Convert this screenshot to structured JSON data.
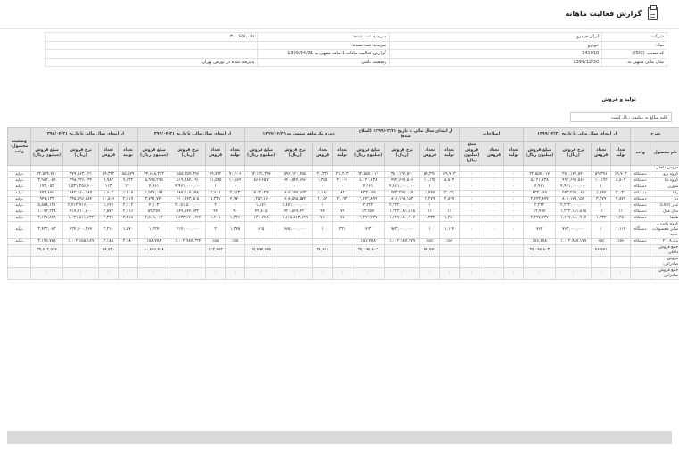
{
  "page": {
    "title": "گزارش فعالیت ماهانه",
    "clipboard_icon": "clipboard-icon"
  },
  "info": [
    [
      "شرکت:",
      "ایران خودرو",
      "سرمایه ثبت شده:",
      "۳۰۱,۶۵۶,۰۶۸"
    ],
    [
      "نماد:",
      "خودرو",
      "سرمایه ثبت نشده:",
      "۰"
    ],
    [
      "کد صنعت (ISIC):",
      "341010",
      "گزارش فعالیت ماهانه 1 ماهه منتهی به 1399/04/31",
      ""
    ],
    [
      "سال مالی منتهی به:",
      "1399/12/30",
      "وضعیت ناشر:",
      "پذیرفته شده در بورس تهران"
    ]
  ],
  "section_title": "تولید و فروش",
  "unit_label": "کلیه مبالغ به میلیون ریال است",
  "table": {
    "group_headers": [
      "شرح",
      "از ابتدای سال مالی تا تاریخ ۱۳۹۹/۰۳/۳۱",
      "اصلاحات",
      "از ابتدای سال مالی تا تاریخ ۱۳۹۹/۰۳/۳۱ (اصلاح شده)",
      "دوره یک ماهه منتهی به ۱۳۹۹/۰۴/۳۱",
      "از ابتدای سال مالی تا تاریخ ۱۳۹۹/۰۴/۳۱",
      "از ابتدای سال مالی تا تاریخ ۱۳۹۸/۰۴/۳۱",
      "وضعیت محصول-واحد"
    ],
    "sub_a": [
      "نام محصول",
      "واحد"
    ],
    "sub_b": [
      "تعداد تولید",
      "تعداد فروش",
      "نرخ فروش (ریال)",
      "مبلغ فروش (میلیون ریال)"
    ],
    "sub_c": [
      "تعداد تولید",
      "تعداد فروش",
      "مبلغ فروش (میلیون ریال)"
    ],
    "rows": [
      {
        "name": "فروش داخلی:",
        "unit": "",
        "v": [
          "",
          "",
          "",
          "",
          "",
          "",
          "",
          "",
          "",
          "",
          "",
          "",
          "",
          "",
          "",
          "",
          "",
          "",
          "",
          "",
          "",
          "",
          "",
          ""
        ],
        "status": ""
      },
      {
        "name": "گروه پژو",
        "unit": "دستگاه",
        "v": [
          "۶۹,۷۰۳",
          "۵۹,۳۹۶",
          "۳۸۰,۱۷۴,۵۴۰",
          "۲۲,۵۵۷,۰۱۷",
          "۰",
          "۰",
          "۰",
          "۶۹,۷۰۳",
          "۵۹,۳۹۶",
          "۳۸۰,۱۷۴,۵۴۰",
          "۲۲,۵۵۷,۰۱۷",
          "۲۱,۲۰۳",
          "۲۰,۳۲۶",
          "۵۹۶,۱۲۰,۴۵۸",
          "۱۲,۱۳۱,۳۴۶",
          "۹۰,۹۰۶",
          "۷۹,۷۲۲",
          "۵۵۸,۳۵۷,۲۹۶",
          "۳۴,۶۸۸,۳۶۳",
          "۸۵,۵۷۹",
          "۵۹,۳۴۲",
          "۳۷۹,۵۶۳,۰۲۱",
          "۲۲,۵۳۴,۷۵۰"
        ],
        "status": "تولید"
      },
      {
        "name": "گروه دنا",
        "unit": "دستگاه",
        "v": [
          "۸,۵۰۳",
          "۱۰,۱۹۲",
          "۴۹۲,۶۹۷,۵۶۶",
          "۵,۰۲۱,۶۳۸",
          "۰",
          "۰",
          "۰",
          "۸,۵۰۳",
          "۱۰,۱۹۲",
          "۴۹۲,۶۹۷,۵۶۶",
          "۵,۰۲۱,۶۳۸",
          "۲,۰۶۱",
          "۱,۳۵۳",
          "۶۴۰,۵۴۴,۶۹۶",
          "۸۶۶,۶۵۷",
          "۱۰,۵۶۴",
          "۱۱,۵۴۵",
          "۵۱۹,۲۸۴,۰۹۱",
          "۵,۹۹۵,۲۹۵",
          "۹,۷۳۲",
          "۹,۹۸۲",
          "۳۹۸,۹۳۶,۰۳۴",
          "۳,۹۸۲,۰۵۹"
        ],
        "status": "تولید"
      },
      {
        "name": "سورن",
        "unit": "دستگاه",
        "v": [
          "۰",
          "۱",
          "۴,۹۶۱,۰۰۰,۰۰۰",
          "۴,۹۶۱",
          "۰",
          "۰",
          "۰",
          "۰",
          "۱",
          "۴,۹۶۱,۰۰۰,۰۰۰",
          "۴,۹۶۱",
          "۰",
          "۰",
          "۰",
          "۰",
          "۰",
          "۱",
          "۴,۹۶۱,۰۰۰,۰۰۰",
          "۴,۹۶۱",
          "۱۲۰",
          "۱۱۳",
          "۱,۵۳۱,۲۵۶,۶۰۰",
          "۱۷۳,۰۵۲"
        ],
        "status": "تولید"
      },
      {
        "name": "رانا",
        "unit": "دستگاه",
        "v": [
          "۲,۰۳۱",
          "۱,۴۴۵",
          "۵۷۳,۲۵۵,۰۶۹",
          "۸۲۳,۰۶۹",
          "۰",
          "۰",
          "۰",
          "۲,۰۳۱",
          "۱,۴۴۵",
          "۵۷۳,۲۵۵,۰۶۹",
          "۸۲۳,۰۶۹",
          "۸۲",
          "۱,۱۶۰",
          "۶۰۵,۱۹۵,۶۵۳",
          "۷۰۳,۰۲۷",
          "۲,۱۱۳",
          "۲,۶۰۵",
          "۵۸۷,۹۰۷,۶۹۸",
          "۱,۵۲۶,۰۹۶",
          "۱,۴۰۷",
          "۱,۶۰۳",
          "۴۸۲,۶۶۰,۱۸۹",
          "۷۷۳,۶۸۵"
        ],
        "status": "تولید"
      },
      {
        "name": "دنا",
        "unit": "دستگاه",
        "v": [
          "۲,۸۷۷",
          "۳,۲۷۹",
          "۸۰۶,۱۷۸,۱۵۳",
          "۲,۶۴۳,۸۹۴",
          "۰",
          "۰",
          "۰",
          "۲,۸۷۷",
          "۳,۲۷۹",
          "۸۰۶,۱۷۸,۱۵۳",
          "۲,۶۴۳,۸۹۴",
          "۲,۰۹۳",
          "۲,۰۵۹",
          "۶۰۸,۵۹۸,۵۷۴",
          "۱,۲۵۳,۱۶۶",
          "۴,۹۷۰",
          "۵,۳۳۸",
          "۷۱۰,۲۴۳,۵۰۵",
          "۳,۷۹۱,۷۴۰",
          "۲,۶۱۷",
          "۱۰,۵۰۶",
          "۳۴۵,۵۹۶,۵۸۴",
          "۹۴۷,۱۳۳"
        ],
        "status": "تولید"
      },
      {
        "name": "تندر (L90)",
        "unit": "دستگاه",
        "v": [
          "۰",
          "۱",
          "۲,۲۲۲,۰۰۰,۰۰۰",
          "۲,۲۲۲",
          "۰",
          "۰",
          "۰",
          "۰",
          "۱",
          "۲,۲۲۲,۰۰۰,۰۰۰",
          "۲,۲۲۲",
          "۰",
          "۱",
          "۱,۸۷۱,۰۰۰,۰۰۰",
          "۱,۸۷۱",
          "۰",
          "۲",
          "۲,۰۵۱,۵۰۰,۰۰۰",
          "۴,۱۰۳",
          "۲,۱۰۲",
          "۱,۶۴۷",
          "۲,۴۱۳,۷۱۶,۰۰۰",
          "۵,۵۸۸,۱۲۶"
        ],
        "status": "تولید"
      },
      {
        "name": "ماک فیک",
        "unit": "دستگاه",
        "v": [
          "۱۱",
          "۱۱",
          "۱,۲۲۲,۱۸۱,۸۱۸",
          "۱۳,۴۵۴",
          "۰",
          "۰",
          "۰",
          "۱۱",
          "۱۱",
          "۱,۲۲۲,۱۸۱,۸۱۸",
          "۱۳,۴۵۴",
          "۷۹",
          "۹۴",
          "۴۲۰,۵۶۹,۴۳۰",
          "۴۲,۸۰۵",
          "۹۰",
          "۹۴",
          "۵۴۹,۵۴۴,۶۳۲",
          "۵۹,۳۵۹",
          "۲,۱۱۶",
          "۲,۵۷۴",
          "۴۱۷,۲۱۰,۸۰۰",
          "۱,۰۷۳,۲۲۸"
        ],
        "status": "تولید"
      },
      {
        "name": "هایما",
        "unit": "دستگاه",
        "v": [
          "۱,۲۵۰",
          "۱,۳۳۲",
          "۱,۶۴۷,۱۸۰,۹۰۷",
          "۲,۲۹۷,۴۳۷",
          "۰",
          "۰",
          "۰",
          "۱,۲۵۰",
          "۱,۳۳۲",
          "۱,۶۴۷,۱۸۰,۹۰۷",
          "۲,۲۹۷,۴۳۷",
          "۷۵",
          "۷۶",
          "۱,۷۱۵,۸۱۳,۵۹۹",
          "۱۳۰,۷۷۸",
          "۱,۳۲۶",
          "۱,۴۰۸",
          "۱,۶۳۳,۱۴۰,۷۴۴",
          "۲,۵۰۹,۰۱۲",
          "۲,۲۶۸",
          "۲,۳۴۷",
          "۱,۰۳۱,۵۱۱,۶۳۲",
          "۲,۱۳۷,۸۴۹"
        ],
        "status": "تولید"
      },
      {
        "name": "گروه وانت و سایر محصولات جدید",
        "unit": "دستگاه",
        "v": [
          "۱,۱۱۴",
          "۱",
          "۷۶۳,۰۰۰,۰۰۰",
          "۷۶۳",
          "۰",
          "۰",
          "۰",
          "۱,۱۱۴",
          "۱",
          "۷۶۳,۰۰۰,۰۰۰",
          "۷۶۳",
          "۲۲۱",
          "۱",
          "۶۶۵,۰۰۰,۰۰۰",
          "۶۶۵",
          "۱,۳۴۵",
          "۲",
          "۷۱۴,۰۰۰,۰۰۰",
          "۱,۴۲۷",
          "۱,۵۷۰",
          "۲,۲۱۰",
          "۶۲۴,۶۰۰,۲۶۷",
          "۳,۴۳۲,۰۸۳"
        ],
        "status": "تولید"
      },
      {
        "name": "پژو ۲۰۰۸",
        "unit": "دستگاه",
        "v": [
          "۱۵۶",
          "۱۵۶",
          "۱,۰۰۲,۹۸۷,۱۷۹",
          "۱۵۶,۷۷۸",
          "۰",
          "۰",
          "۰",
          "۱۵۶",
          "۱۵۶",
          "۱,۰۰۲,۹۸۷,۱۷۹",
          "۱۵۶,۷۷۸",
          "۰",
          "۰",
          "۰",
          "۰",
          "۱۵۸",
          "۱۵۸",
          "۱,۰۰۲,۹۸۷,۳۲۴",
          "۱۵۸,۷۷۸",
          "۲,۱۸۰",
          "۳,۱۸۵",
          "۱,۰۰۲,۶۵۵,۱۸۹",
          "۳,۱۹۵,۷۵۹"
        ],
        "status": "تولید"
      },
      {
        "name": "جمع فروش داخلی",
        "unit": "",
        "v": [
          "",
          "۷۶,۷۷۱",
          "",
          "۳۵,۰۹۸,۸۰۳",
          "",
          "",
          "",
          "",
          "۷۶,۷۷۱",
          "",
          "۳۵,۰۹۸,۸۰۳",
          "",
          "۲۶,۶۱۱",
          "",
          "۱۵,۷۷۷,۶۴۵",
          "",
          "۱۰۳,۹۸۳",
          "",
          "۶۰,۸۷۶,۴۶۸",
          "",
          "۸۹,۷۳۰",
          "",
          "۳۹,۵۰۲,۵۶۷"
        ],
        "status": ""
      },
      {
        "name": "فروش صادراتی:",
        "unit": "",
        "v": [
          "",
          "",
          "",
          "",
          "",
          "",
          "",
          "",
          "",
          "",
          "",
          "",
          "",
          "",
          "",
          "",
          "",
          "",
          "",
          "",
          "",
          "",
          ""
        ],
        "status": ""
      },
      {
        "name": "جمع فروش صادراتی",
        "unit": "",
        "v": [
          "۰",
          "۰",
          "۰",
          "۰",
          "۰",
          "۰",
          "۰",
          "۰",
          "۰",
          "۰",
          "۰",
          "۰",
          "۰",
          "۰",
          "۰",
          "۰",
          "۰",
          "۰",
          "۰",
          "۰",
          "۰",
          "۰",
          "۰"
        ],
        "status": ""
      }
    ]
  }
}
